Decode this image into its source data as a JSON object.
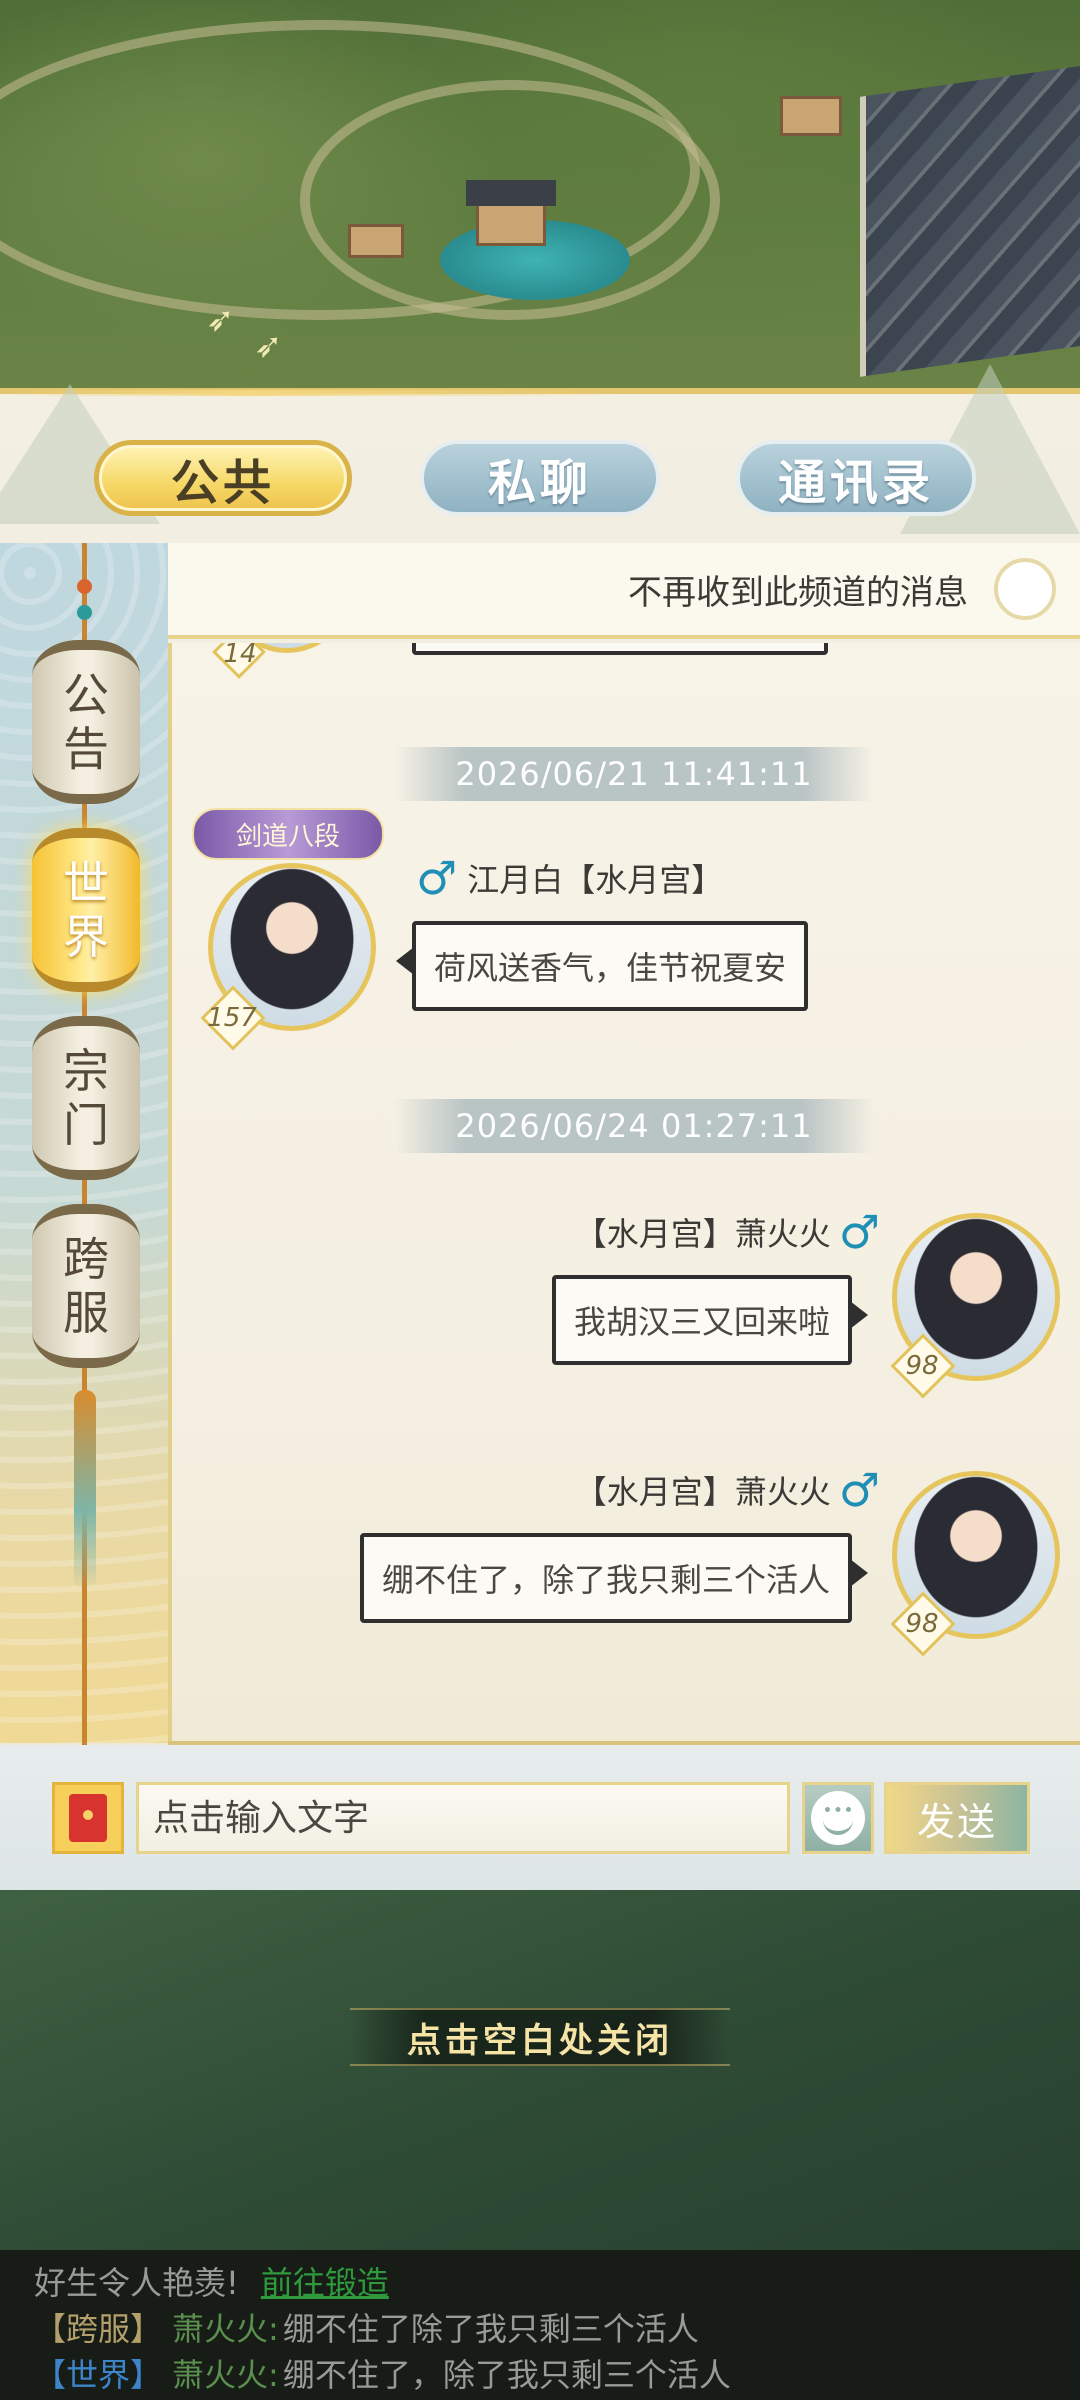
{
  "tabs": {
    "public": "公共",
    "private": "私聊",
    "contacts": "通讯录"
  },
  "header": {
    "mute_label": "不再收到此频道的消息"
  },
  "sidebar": {
    "items": [
      {
        "label_top": "公",
        "label_bottom": "告",
        "active": false
      },
      {
        "label_top": "世",
        "label_bottom": "界",
        "active": true
      },
      {
        "label_top": "宗",
        "label_bottom": "门",
        "active": false
      },
      {
        "label_top": "跨",
        "label_bottom": "服",
        "active": false
      }
    ]
  },
  "messages": {
    "partial_level": "14",
    "ts1": "2026/06/21  11:41:11",
    "msg1": {
      "title_badge": "剑道八段",
      "gender": "♂",
      "name": "江月白【水月宫】",
      "level": "157",
      "text": "荷风送香气，佳节祝夏安"
    },
    "ts2": "2026/06/24  01:27:11",
    "msg2": {
      "name": "【水月宫】萧火火",
      "gender": "♂",
      "level": "98",
      "text": "我胡汉三又回来啦"
    },
    "msg3": {
      "name": "【水月宫】萧火火",
      "gender": "♂",
      "level": "98",
      "text": "绷不住了，除了我只剩三个活人"
    }
  },
  "input": {
    "placeholder": "点击输入文字",
    "send_label": "发送"
  },
  "close_hint": "点击空白处关闭",
  "ticker": {
    "line1_text": "好生令人艳羡!",
    "line1_link": "前往锻造",
    "line2_channel": "【跨服】",
    "line2_name": "萧火火:",
    "line2_text": "绷不住了除了我只剩三个活人",
    "line3_channel": "【世界】",
    "line3_name": "萧火火:",
    "line3_text": "绷不住了，除了我只剩三个活人"
  },
  "colors": {
    "active_tab": "#f6d866",
    "inactive_tab": "#8fb2c2",
    "gender_male": "#1f8fb6",
    "link_green": "#2e9a3c",
    "world_channel": "#3d84c9"
  }
}
